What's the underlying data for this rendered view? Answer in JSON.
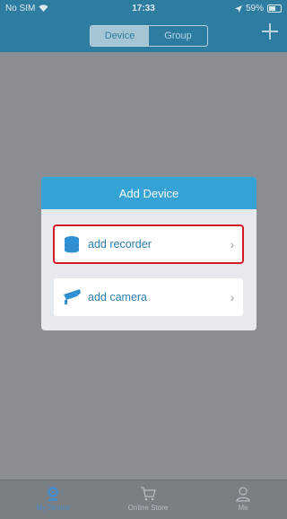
{
  "status": {
    "carrier": "No SIM",
    "time": "17:33",
    "battery": "59%"
  },
  "nav": {
    "segments": [
      "Device",
      "Group"
    ],
    "active_segment": 0
  },
  "dialog": {
    "title": "Add Device",
    "options": [
      {
        "label": "add recorder",
        "icon": "recorder-icon",
        "highlighted": true
      },
      {
        "label": "add camera",
        "icon": "camera-icon",
        "highlighted": false
      }
    ]
  },
  "tabs": [
    {
      "label": "My Device",
      "icon": "device-icon",
      "active": true
    },
    {
      "label": "Online Store",
      "icon": "cart-icon",
      "active": false
    },
    {
      "label": "Me",
      "icon": "person-icon",
      "active": false
    }
  ],
  "colors": {
    "primary": "#2c7da0",
    "dialog_header": "#36a3d6",
    "highlight": "#d51b25",
    "tab_active": "#4a8cc4"
  }
}
